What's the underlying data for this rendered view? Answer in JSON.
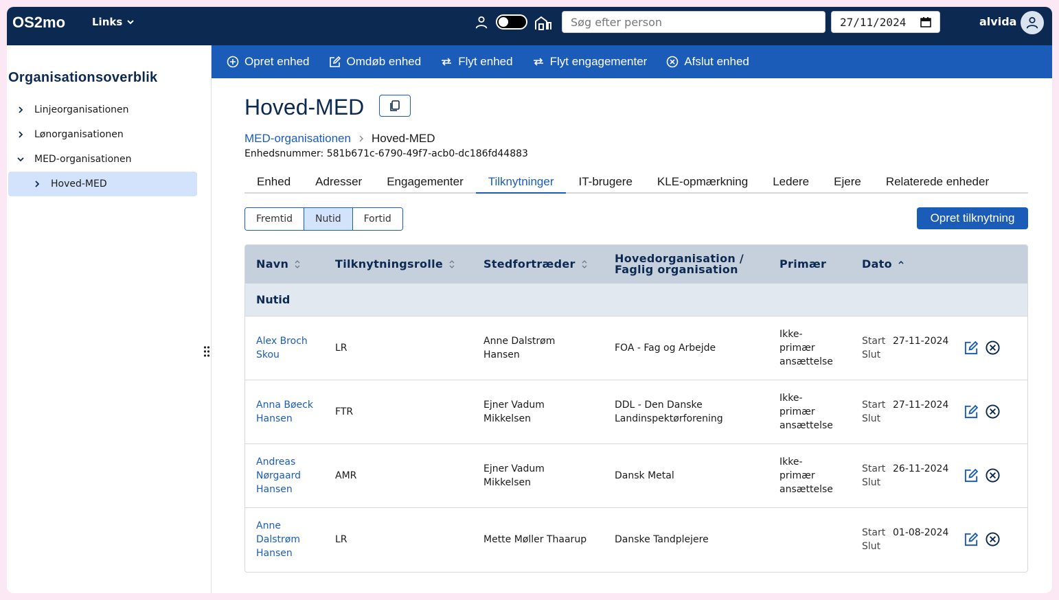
{
  "header": {
    "logo": "OS2mo",
    "links_label": "Links",
    "search_placeholder": "Søg efter person",
    "date_value": "27/11/2024",
    "username": "alvida"
  },
  "sidebar": {
    "title": "Organisationsoverblik",
    "items": [
      {
        "label": "Linjeorganisationen",
        "expanded": false
      },
      {
        "label": "Lønorganisationen",
        "expanded": false
      },
      {
        "label": "MED-organisationen",
        "expanded": true
      },
      {
        "label": "Hoved-MED",
        "selected": true
      }
    ]
  },
  "actions": [
    {
      "label": "Opret enhed",
      "icon": "plus-circle-icon"
    },
    {
      "label": "Omdøb enhed",
      "icon": "edit-icon"
    },
    {
      "label": "Flyt enhed",
      "icon": "arrows-left-right-icon"
    },
    {
      "label": "Flyt engagementer",
      "icon": "arrows-left-right-icon"
    },
    {
      "label": "Afslut enhed",
      "icon": "x-circle-icon"
    }
  ],
  "page": {
    "title": "Hoved-MED",
    "breadcrumb": {
      "parent": "MED-organisationen",
      "current": "Hoved-MED"
    },
    "unit_number": "Enhedsnummer: 581b671c-6790-49f7-acb0-dc186fd44883"
  },
  "tabs": [
    "Enhed",
    "Adresser",
    "Engagementer",
    "Tilknytninger",
    "IT-brugere",
    "KLE-opmærkning",
    "Ledere",
    "Ejere",
    "Relaterede enheder"
  ],
  "active_tab": "Tilknytninger",
  "time_filter": {
    "options": [
      "Fremtid",
      "Nutid",
      "Fortid"
    ],
    "selected": "Nutid"
  },
  "create_button": "Opret tilknytning",
  "table": {
    "headers": {
      "name": "Navn",
      "role": "Tilknytningsrolle",
      "substitute": "Stedfortræder",
      "org_line1": "Hovedorganisation /",
      "org_line2": "Faglig organisation",
      "primary": "Primær",
      "date": "Dato"
    },
    "group_label": "Nutid",
    "start_label": "Start",
    "end_label": "Slut",
    "rows": [
      {
        "name": [
          "Alex Broch",
          "Skou"
        ],
        "role": "LR",
        "substitute": [
          "Anne Dalstrøm",
          "Hansen"
        ],
        "org": [
          "FOA - Fag og Arbejde"
        ],
        "primary": [
          "Ikke-",
          "primær",
          "ansættelse"
        ],
        "start": "27-11-2024",
        "end": ""
      },
      {
        "name": [
          "Anna Bøeck",
          "Hansen"
        ],
        "role": "FTR",
        "substitute": [
          "Ejner Vadum",
          "Mikkelsen"
        ],
        "org": [
          "DDL - Den Danske",
          "Landinspektørforening"
        ],
        "primary": [
          "Ikke-",
          "primær",
          "ansættelse"
        ],
        "start": "27-11-2024",
        "end": ""
      },
      {
        "name": [
          "Andreas",
          "Nørgaard",
          "Hansen"
        ],
        "role": "AMR",
        "substitute": [
          "Ejner Vadum",
          "Mikkelsen"
        ],
        "org": [
          "Dansk Metal"
        ],
        "primary": [
          "Ikke-",
          "primær",
          "ansættelse"
        ],
        "start": "26-11-2024",
        "end": ""
      },
      {
        "name": [
          "Anne",
          "Dalstrøm",
          "Hansen"
        ],
        "role": "LR",
        "substitute": [
          "Mette Møller Thaarup"
        ],
        "org": [
          "Danske Tandplejere"
        ],
        "primary": [],
        "start": "01-08-2024",
        "end": ""
      }
    ]
  },
  "colors": {
    "navy": "#0c2a51",
    "blue": "#1a5cb8",
    "selected": "#d3e3fb",
    "table_header": "#c6d0dc"
  }
}
